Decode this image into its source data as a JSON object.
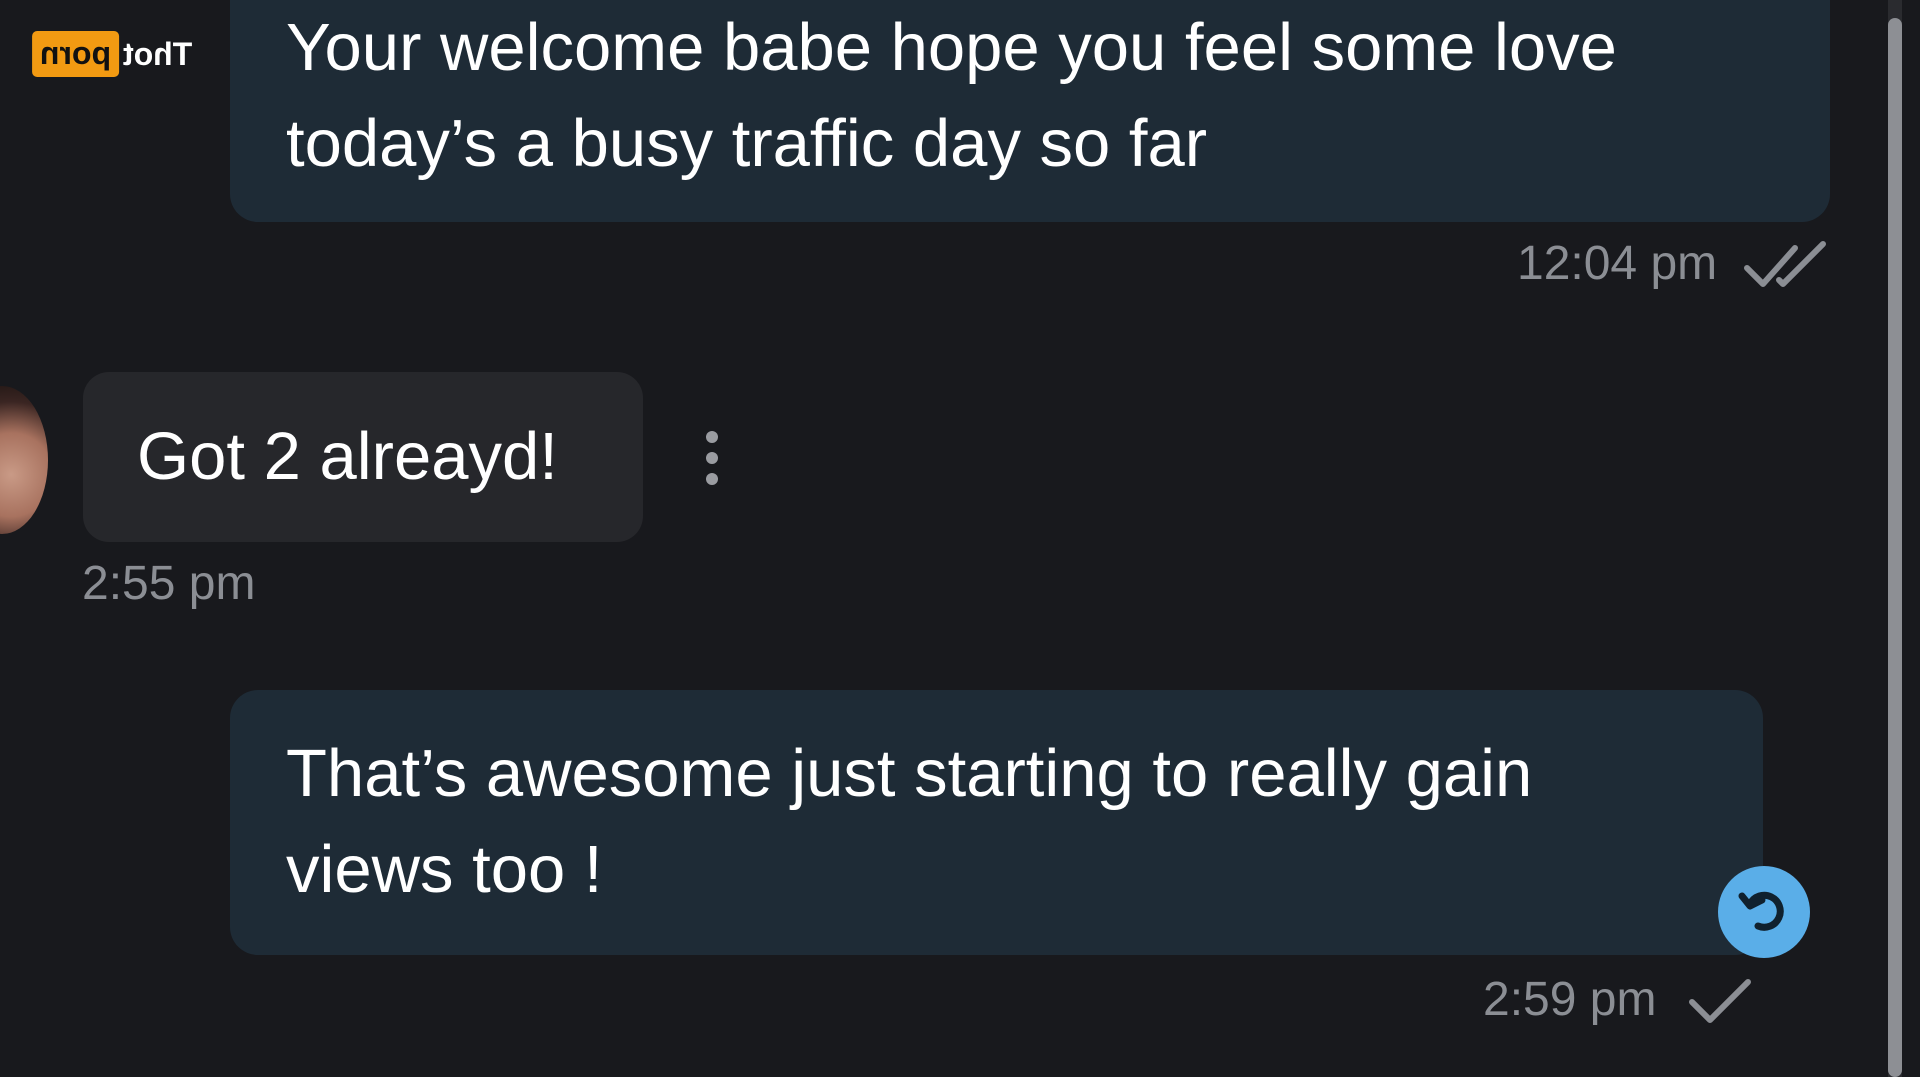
{
  "watermark": {
    "left_text": "porn",
    "right_text": "Thot"
  },
  "messages": [
    {
      "direction": "outgoing",
      "text": "Your welcome babe hope you feel some love today’s a busy traffic day so far",
      "time": "12:04 pm",
      "status": "read-double-check-icon"
    },
    {
      "direction": "incoming",
      "text": "Got 2 alreayd!",
      "time": "2:55 pm"
    },
    {
      "direction": "outgoing",
      "text": "That’s awesome just starting to really gain views too !",
      "time": "2:59 pm",
      "status": "sent-single-check-icon"
    }
  ],
  "colors": {
    "background": "#18191d",
    "outgoing_bubble": "#1e2b36",
    "incoming_bubble": "#26272b",
    "reply_button": "#5aaee8",
    "watermark_accent": "#f29a12"
  },
  "icons": {
    "menu": "vertical-dots-icon",
    "reply": "reply-arrow-icon"
  }
}
